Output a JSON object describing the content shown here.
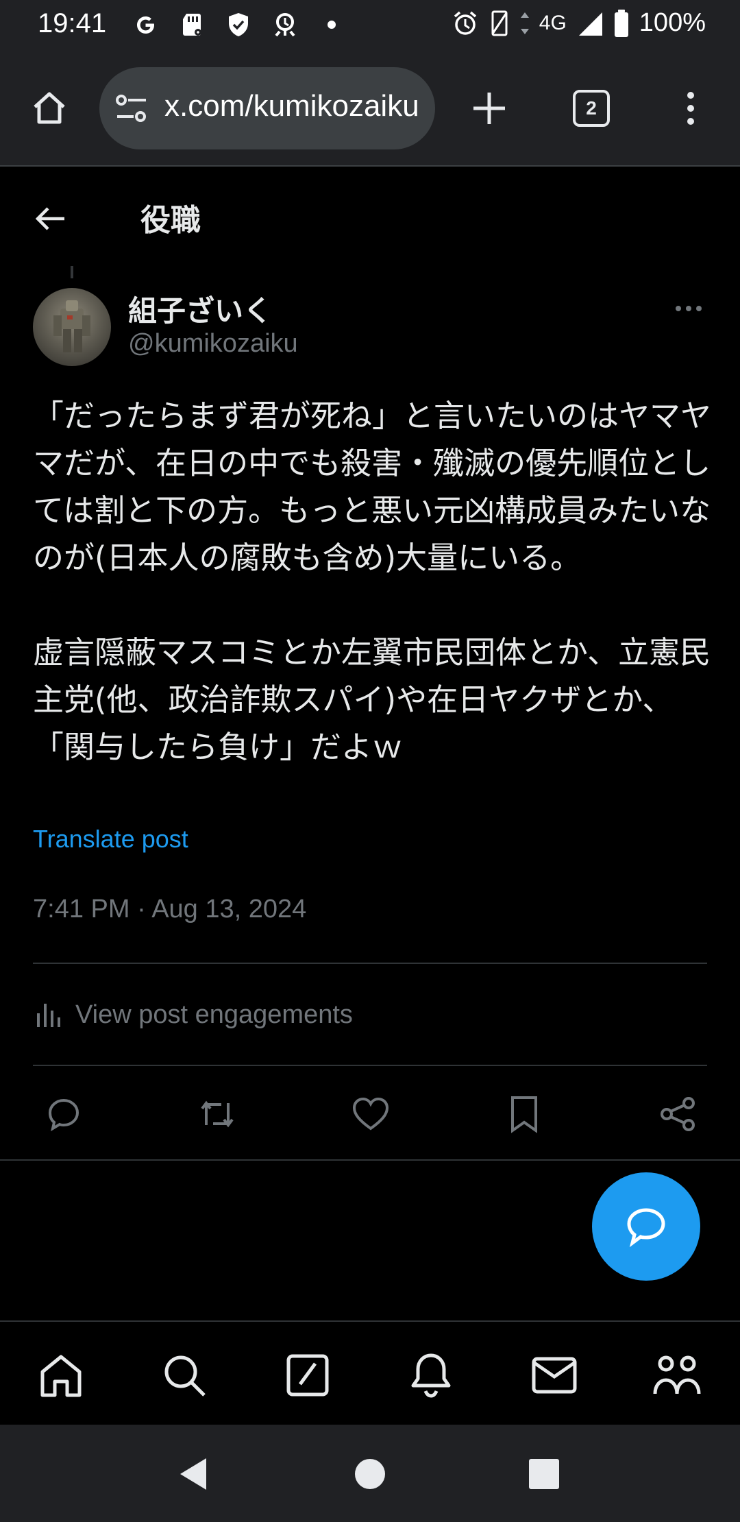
{
  "status_bar": {
    "time": "19:41",
    "left_icons": [
      "google-icon",
      "sd-card-icon",
      "shield-check-icon",
      "bug-icon",
      "dot-icon"
    ],
    "network": "4G",
    "battery": "100%",
    "right_icons": [
      "alarm-icon",
      "vibrate-icon",
      "data-arrows-icon",
      "signal-icon",
      "battery-icon"
    ]
  },
  "browser": {
    "url": "x.com/kumikozaiku",
    "tab_count": "2",
    "icons": [
      "home-icon",
      "site-info-icon",
      "new-tab-icon",
      "tabs-icon",
      "menu-icon"
    ]
  },
  "header": {
    "title": "役職"
  },
  "post": {
    "display_name": "組子ざいく",
    "handle": "@kumikozaiku",
    "paragraph1": "「だったらまず君が死ね」と言いたいのはヤマヤマだが、在日の中でも殺害・殲滅の優先順位としては割と下の方。もっと悪い元凶構成員みたいなのが(日本人の腐敗も含め)大量にいる。",
    "paragraph2": "虚言隠蔽マスコミとか左翼市民団体とか、立憲民主党(他、政治詐欺スパイ)や在日ヤクザとか、「関与したら負け」だよｗ",
    "translate_label": "Translate post",
    "timestamp": "7:41 PM · Aug 13, 2024",
    "engagements_label": "View post engagements"
  },
  "actions": [
    "reply-icon",
    "repost-icon",
    "like-icon",
    "bookmark-icon",
    "share-icon"
  ],
  "bottom_nav": [
    "home-icon",
    "search-icon",
    "grok-icon",
    "notifications-icon",
    "messages-icon",
    "communities-icon"
  ],
  "colors": {
    "background": "#000000",
    "accent": "#1d9bf0",
    "text": "#e7e9ea",
    "secondary_text": "#71767b",
    "browser_chrome": "#202124"
  }
}
